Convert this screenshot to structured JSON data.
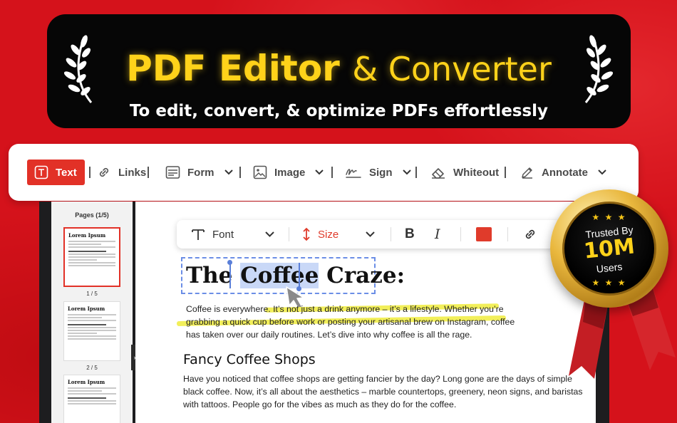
{
  "banner": {
    "title_main": "PDF Editor",
    "title_amp": "& Converter",
    "subtitle": "To edit, convert, & optimize PDFs effortlessly"
  },
  "toolbar": {
    "text_label": "Text",
    "links_label": "Links",
    "form_label": "Form",
    "image_label": "Image",
    "sign_label": "Sign",
    "whiteout_label": "Whiteout",
    "annotate_label": "Annotate"
  },
  "sidebar": {
    "pages_label": "Pages (1/5)",
    "thumb_title": "Lorem Ipsum",
    "page_labels": [
      "1 / 5",
      "2 / 5"
    ]
  },
  "format_bar": {
    "font_label": "Font",
    "size_label": "Size",
    "bold_label": "B",
    "italic_label": "I",
    "text_color": "#e03b2b"
  },
  "document": {
    "heading_before": "The ",
    "heading_selected": "Coffee",
    "heading_after": " Craze:",
    "para1_lines": [
      "Coffee is everywhere. It’s not just a drink anymore – it’s a lifestyle. Whether you’re",
      "grabbing a quick cup before work or posting your artisanal brew on Instagram, coffee",
      "has taken over our daily routines. Let’s dive into why coffee is all the rage."
    ],
    "subheading": "Fancy Coffee Shops",
    "para2_lines": [
      "Have you noticed that coffee shops are getting fancier by the day? Long gone are the days of simple",
      "black coffee. Now, it’s all about the aesthetics – marble countertops, greenery, neon signs, and baristas",
      "with tattoos. People go for the vibes as much as they do for the coffee."
    ]
  },
  "badge": {
    "line1": "Trusted By",
    "line2": "10M",
    "line3": "Users",
    "stars_top": "★ ★ ★",
    "stars_bottom": "★ ★ ★"
  },
  "colors": {
    "background": "#d5121b",
    "accent": "#e23127",
    "banner_text": "#ffd21a",
    "highlight": "#f2ef5a",
    "selection": "#c9d8f7"
  }
}
